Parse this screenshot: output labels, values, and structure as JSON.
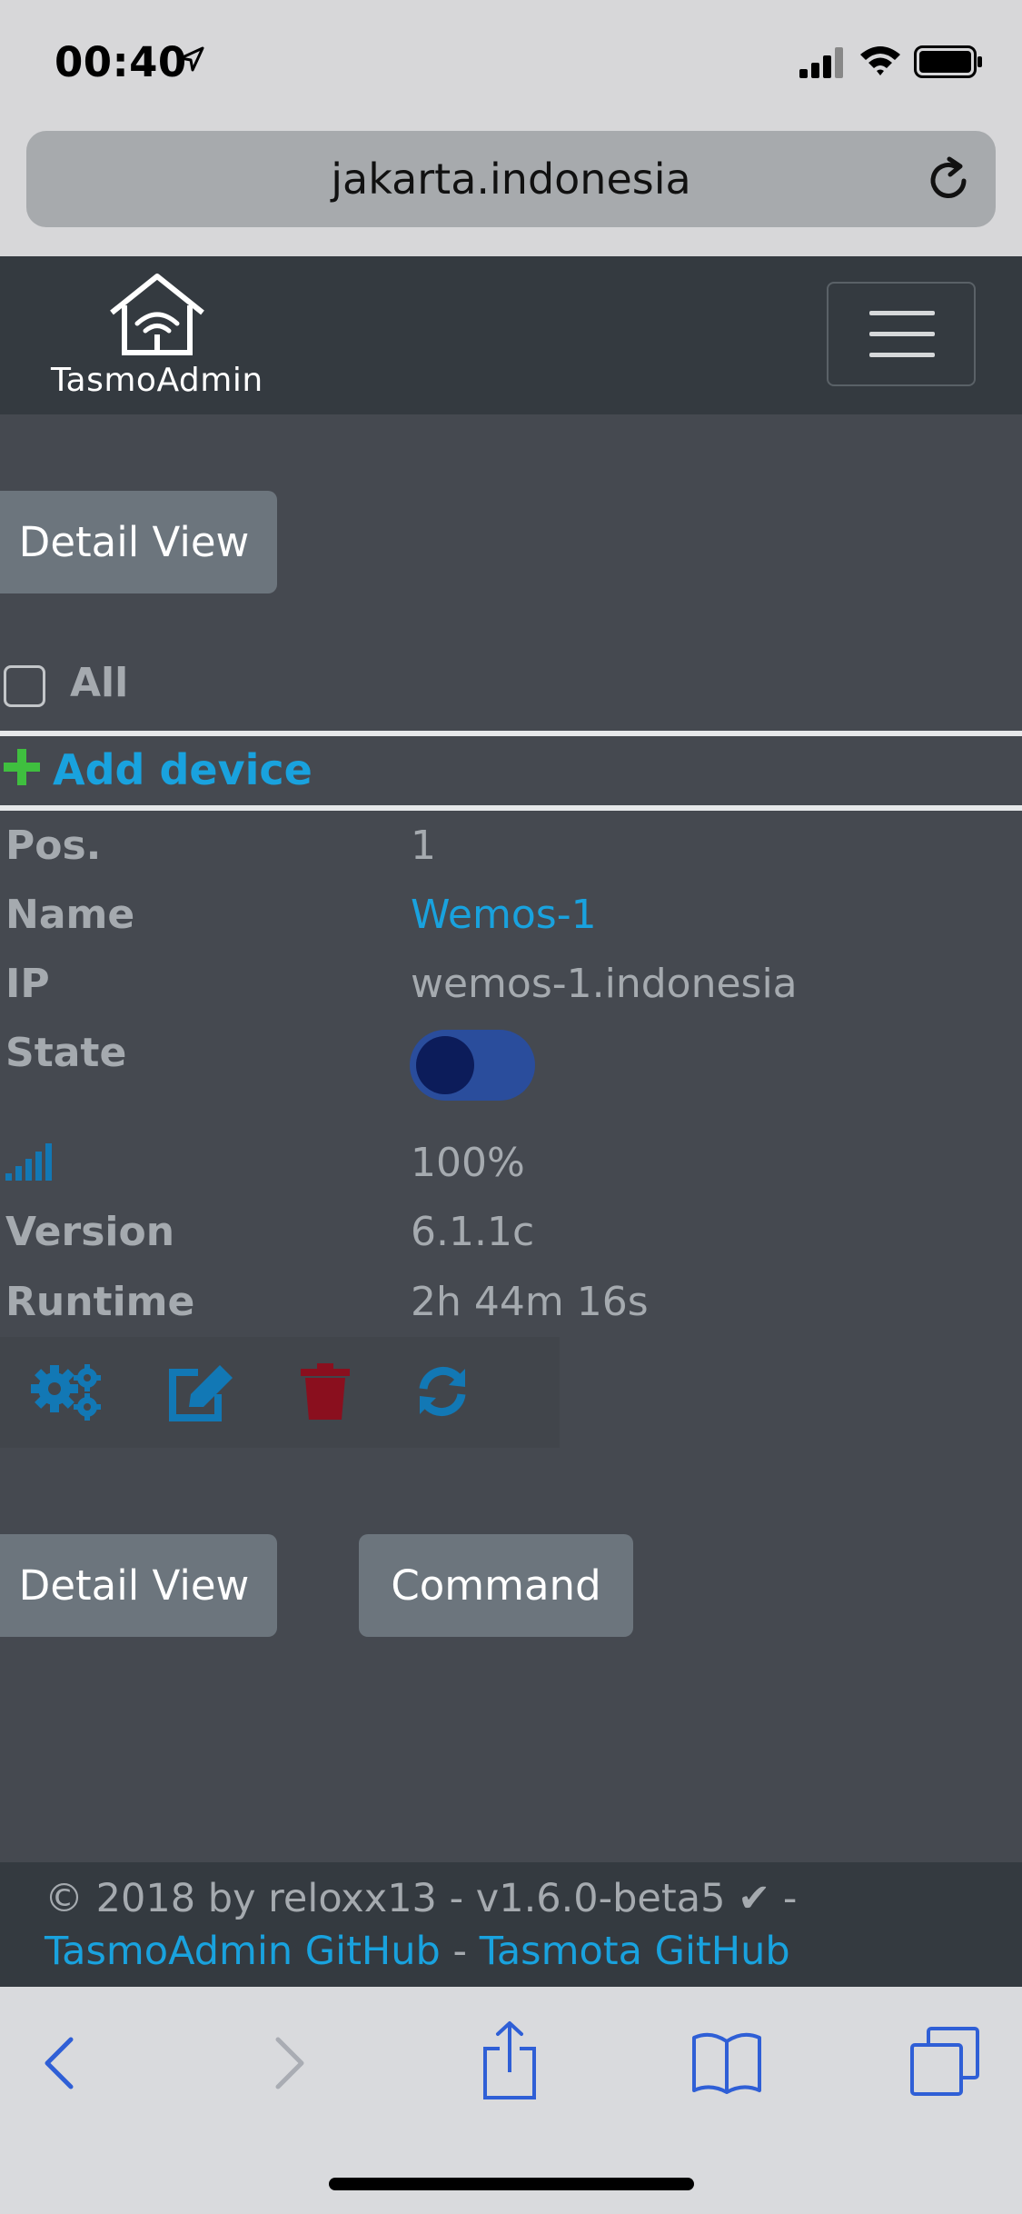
{
  "status_bar": {
    "time": "00:40"
  },
  "browser": {
    "url": "jakarta.indonesia"
  },
  "navbar": {
    "brand": "TasmoAdmin"
  },
  "actions": {
    "detail_view": "Detail View",
    "command": "Command"
  },
  "select_all": {
    "label": "All"
  },
  "add_device": {
    "label": "Add device"
  },
  "device": {
    "labels": {
      "pos": "Pos.",
      "name": "Name",
      "ip": "IP",
      "state": "State",
      "version": "Version",
      "runtime": "Runtime"
    },
    "pos": "1",
    "name": "Wemos-1",
    "ip": "wemos-1.indonesia",
    "state_on": true,
    "rssi": "100%",
    "version": "6.1.1c",
    "runtime": "2h 44m 16s"
  },
  "footer": {
    "copyright": "© 2018 by reloxx13 - v1.6.0-beta5",
    "check": "✔",
    "sep": " - ",
    "link_admin": "TasmoAdmin GitHub",
    "link_tasmota": "Tasmota GitHub"
  },
  "colors": {
    "accent": "#19a2de",
    "button": "#6c757d",
    "content_bg": "#454950",
    "navbar_bg": "#343a40",
    "delete_red": "#8a0f1e",
    "add_green": "#3fbf3f"
  },
  "icons": {
    "status": [
      "location-arrow-icon",
      "cellular-signal-icon",
      "wifi-icon",
      "battery-icon"
    ],
    "device_actions": [
      "settings-icon",
      "edit-icon",
      "delete-icon",
      "refresh-icon"
    ],
    "toolbar": [
      "back-icon",
      "forward-icon",
      "share-icon",
      "bookmarks-icon",
      "tabs-icon"
    ]
  }
}
